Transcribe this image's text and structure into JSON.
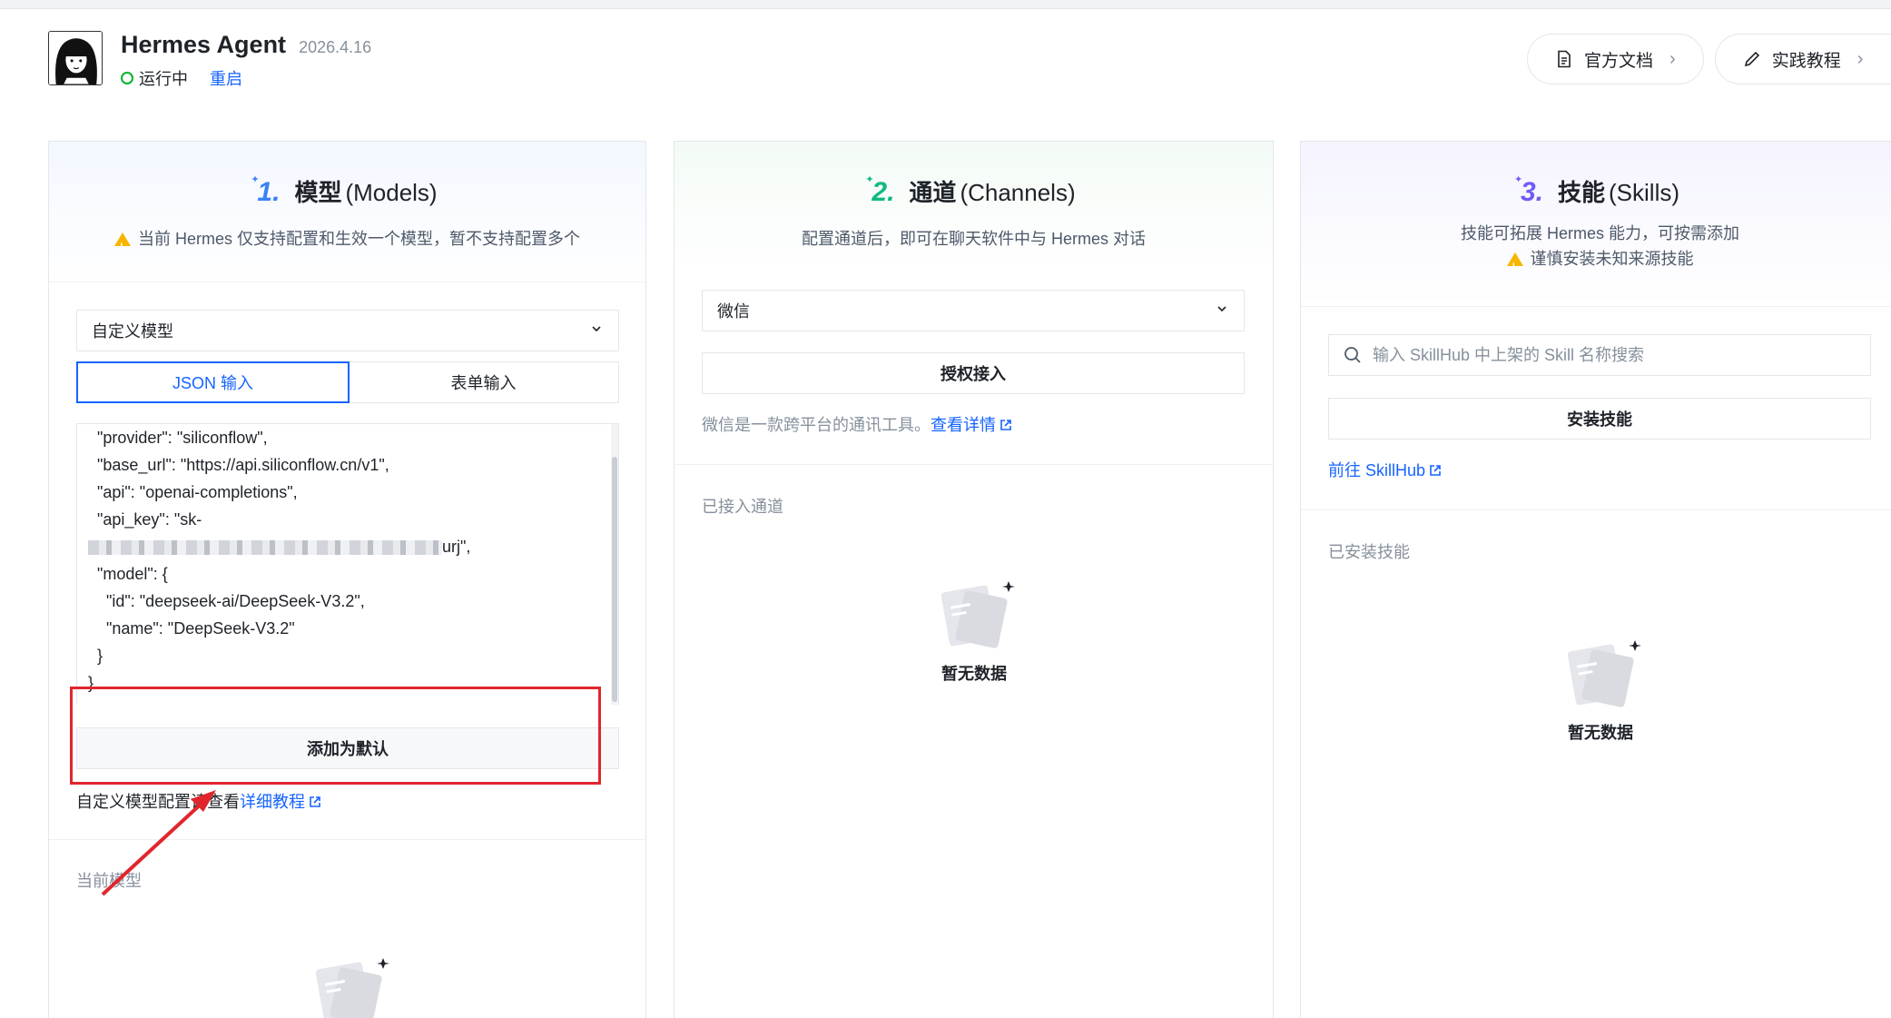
{
  "header": {
    "title": "Hermes Agent",
    "version": "2026.4.16",
    "status": "运行中",
    "restart": "重启",
    "docs_button": "官方文档",
    "tutorial_button": "实践教程"
  },
  "models": {
    "number": "1.",
    "title": "模型",
    "subtitle": "(Models)",
    "warning": "当前 Hermes 仅支持配置和生效一个模型，暂不支持配置多个",
    "select_value": "自定义模型",
    "tab_json": "JSON 输入",
    "tab_form": "表单输入",
    "code_lines": [
      "  \"provider\": \"siliconflow\",",
      "  \"base_url\": \"https://api.siliconflow.cn/v1\",",
      "  \"api\": \"openai-completions\",",
      "  \"api_key\": \"sk-",
      "urj\",",
      "  \"model\": {",
      "    \"id\": \"deepseek-ai/DeepSeek-V3.2\",",
      "    \"name\": \"DeepSeek-V3.2\"",
      "  }",
      "}"
    ],
    "add_default_button": "添加为默认",
    "help_prefix": "自定义模型配置请查看",
    "help_link": "详细教程",
    "current_label": "当前模型"
  },
  "channels": {
    "number": "2.",
    "title": "通道",
    "subtitle": "(Channels)",
    "desc": "配置通道后，即可在聊天软件中与 Hermes 对话",
    "select_value": "微信",
    "authorize_button": "授权接入",
    "info_text": "微信是一款跨平台的通讯工具。",
    "info_link": "查看详情",
    "connected_label": "已接入通道",
    "empty_text": "暂无数据"
  },
  "skills": {
    "number": "3.",
    "title": "技能",
    "subtitle": "(Skills)",
    "desc": "技能可拓展 Hermes 能力，可按需添加",
    "warning": "谨慎安装未知来源技能",
    "search_placeholder": "输入 SkillHub 中上架的 Skill 名称搜索",
    "install_button": "安装技能",
    "skillhub_link": "前往 SkillHub",
    "installed_label": "已安装技能",
    "empty_text": "暂无数据"
  },
  "colors": {
    "accent": "#1664ff",
    "status_green": "#00b42a",
    "highlight_red": "#e0262d"
  }
}
